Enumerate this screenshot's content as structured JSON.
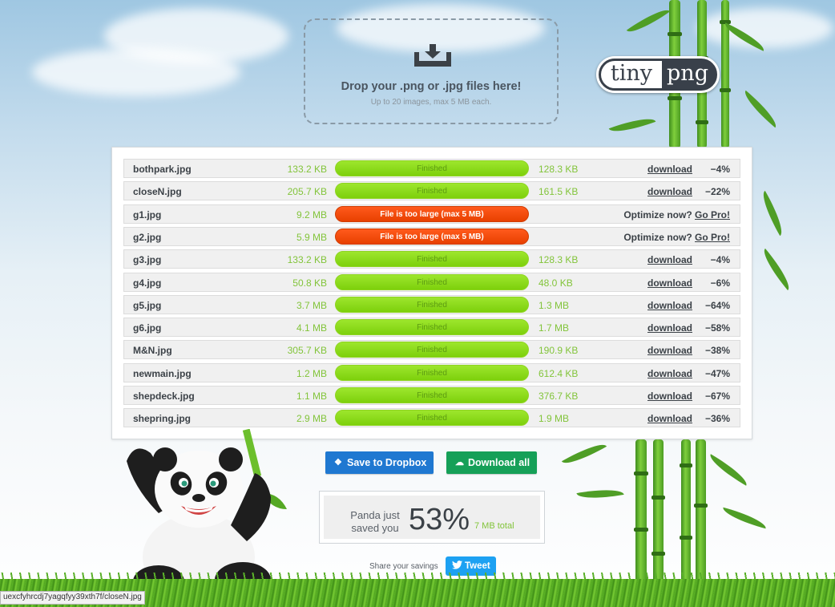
{
  "dropzone": {
    "title": "Drop your .png or .jpg files here!",
    "subtitle": "Up to 20 images, max 5 MB each."
  },
  "logo": {
    "left_word": "tiny",
    "right_word": "png"
  },
  "results": [
    {
      "name": "bothpark.jpg",
      "original": "133.2 KB",
      "status": "Finished",
      "ok": true,
      "new_size": "128.3 KB",
      "action": "download",
      "percent": "−4%"
    },
    {
      "name": "closeN.jpg",
      "original": "205.7 KB",
      "status": "Finished",
      "ok": true,
      "new_size": "161.5 KB",
      "action": "download",
      "percent": "−22%"
    },
    {
      "name": "g1.jpg",
      "original": "9.2 MB",
      "status": "File is too large (max 5 MB)",
      "ok": false,
      "pro_text": "Optimize now?",
      "pro_link": "Go Pro!"
    },
    {
      "name": "g2.jpg",
      "original": "5.9 MB",
      "status": "File is too large (max 5 MB)",
      "ok": false,
      "pro_text": "Optimize now?",
      "pro_link": "Go Pro!"
    },
    {
      "name": "g3.jpg",
      "original": "133.2 KB",
      "status": "Finished",
      "ok": true,
      "new_size": "128.3 KB",
      "action": "download",
      "percent": "−4%"
    },
    {
      "name": "g4.jpg",
      "original": "50.8 KB",
      "status": "Finished",
      "ok": true,
      "new_size": "48.0 KB",
      "action": "download",
      "percent": "−6%"
    },
    {
      "name": "g5.jpg",
      "original": "3.7 MB",
      "status": "Finished",
      "ok": true,
      "new_size": "1.3 MB",
      "action": "download",
      "percent": "−64%"
    },
    {
      "name": "g6.jpg",
      "original": "4.1 MB",
      "status": "Finished",
      "ok": true,
      "new_size": "1.7 MB",
      "action": "download",
      "percent": "−58%"
    },
    {
      "name": "M&N.jpg",
      "original": "305.7 KB",
      "status": "Finished",
      "ok": true,
      "new_size": "190.9 KB",
      "action": "download",
      "percent": "−38%"
    },
    {
      "name": "newmain.jpg",
      "original": "1.2 MB",
      "status": "Finished",
      "ok": true,
      "new_size": "612.4 KB",
      "action": "download",
      "percent": "−47%"
    },
    {
      "name": "shepdeck.jpg",
      "original": "1.1 MB",
      "status": "Finished",
      "ok": true,
      "new_size": "376.7 KB",
      "action": "download",
      "percent": "−67%"
    },
    {
      "name": "shepring.jpg",
      "original": "2.9 MB",
      "status": "Finished",
      "ok": true,
      "new_size": "1.9 MB",
      "action": "download",
      "percent": "−36%"
    }
  ],
  "buttons": {
    "dropbox": "Save to Dropbox",
    "download_all": "Download all"
  },
  "savings": {
    "label": "Panda just saved you",
    "percent": "53%",
    "total": "7 MB total"
  },
  "share": {
    "label": "Share your savings",
    "tweet": "Tweet"
  },
  "statusbar": {
    "url": "uexcfyhrcdj7yagqfyy39xth7f/closeN.jpg"
  },
  "icons": {
    "upload": "tray-download-icon",
    "dropbox": "dropbox-icon",
    "download_all": "cloud-download-icon",
    "tweet": "twitter-bird-icon"
  },
  "colors": {
    "finished_bar": "#7dd00c",
    "error_bar": "#e84000",
    "dropbox_button": "#1f78d1",
    "download_all_button": "#16a058",
    "tweet_button": "#1da1f2"
  }
}
